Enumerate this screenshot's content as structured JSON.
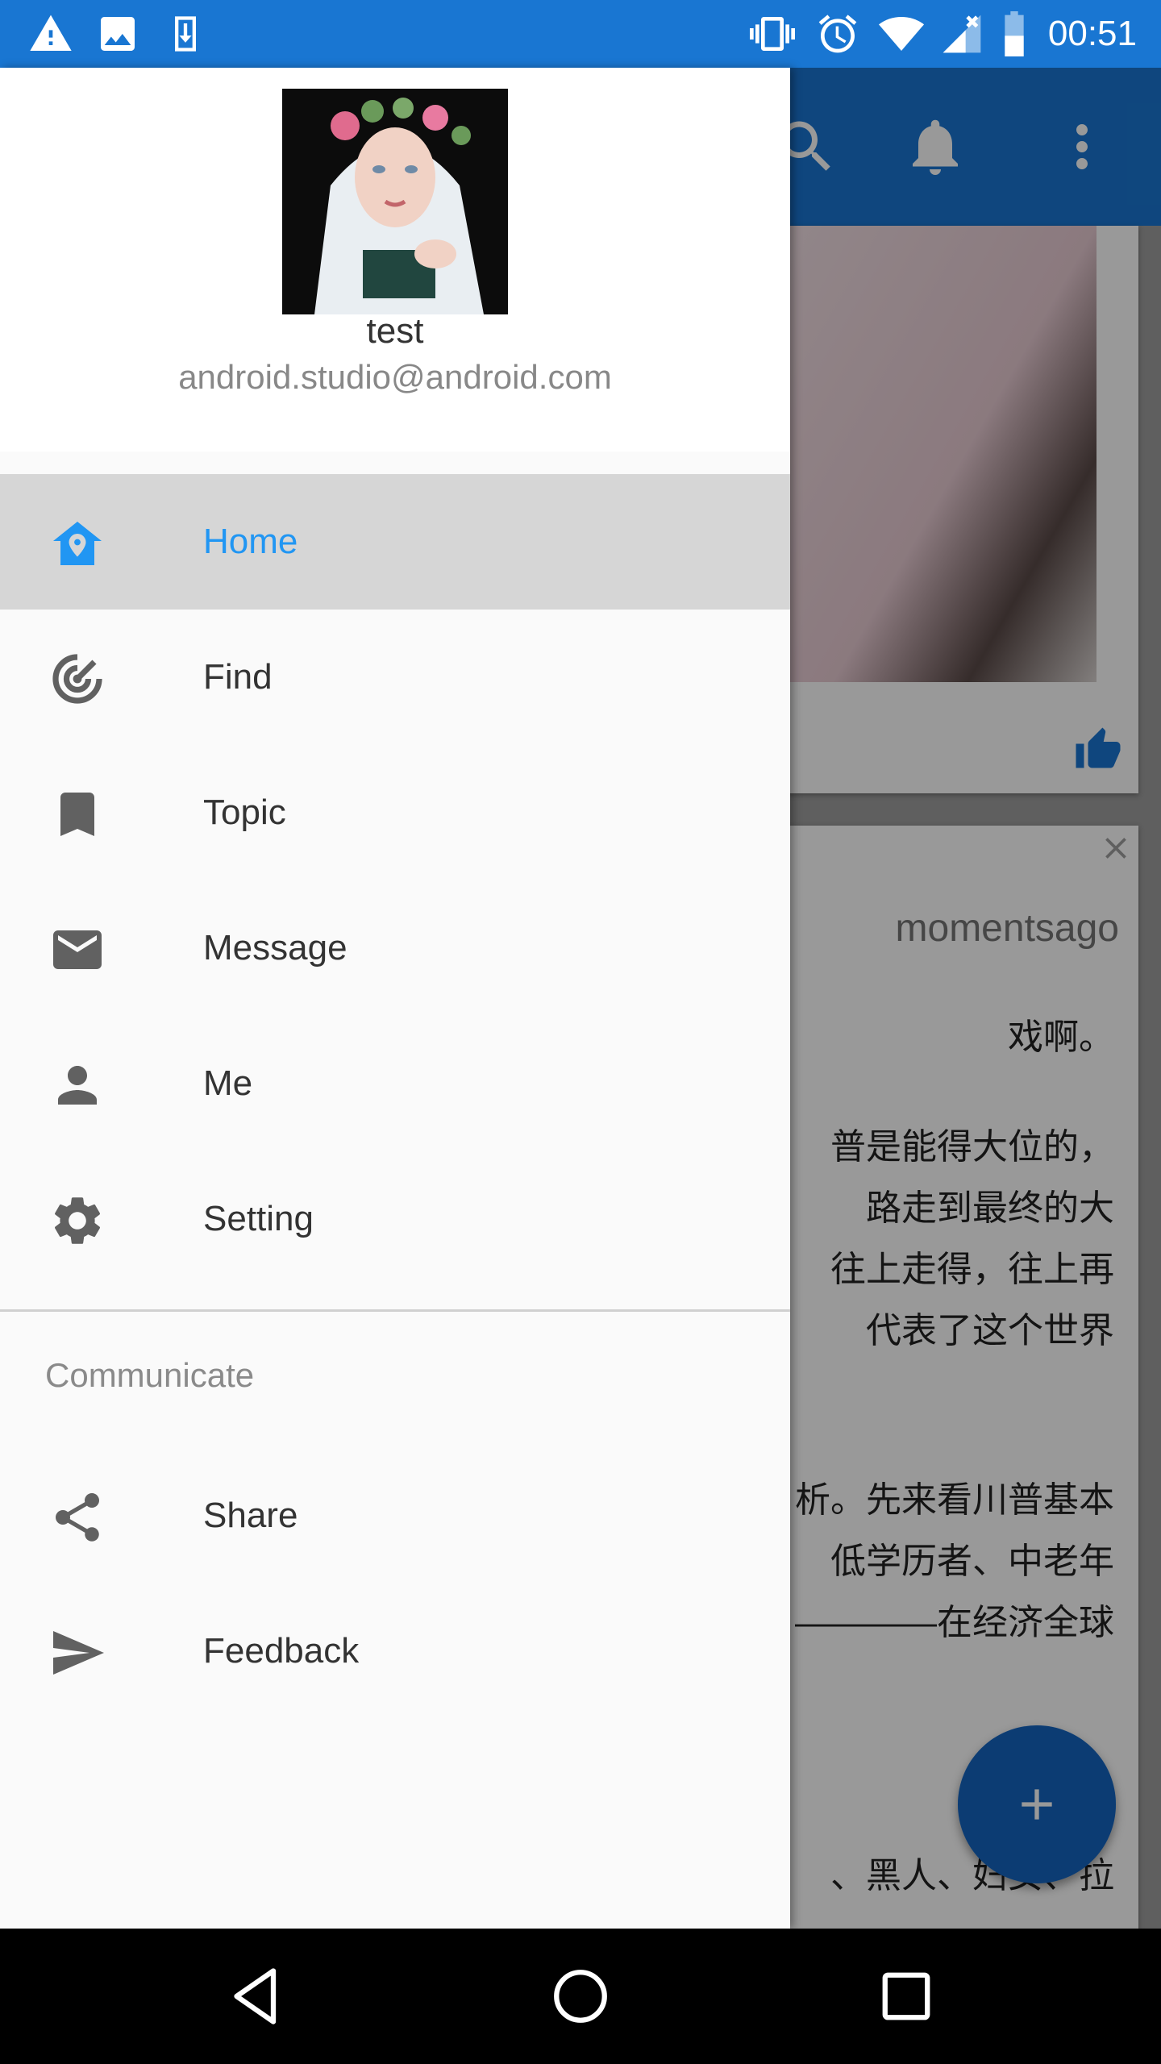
{
  "status_bar": {
    "time": "00:51",
    "left_icons": [
      "warning-icon",
      "image-icon",
      "download-icon"
    ],
    "right_icons": [
      "vibrate-icon",
      "alarm-icon",
      "wifi-icon",
      "signal-icon",
      "battery-icon"
    ]
  },
  "drawer": {
    "header": {
      "name": "test",
      "email": "android.studio@android.com"
    },
    "items": [
      {
        "label": "Home",
        "icon": "home-pin-icon",
        "active": true
      },
      {
        "label": "Find",
        "icon": "radar-icon"
      },
      {
        "label": "Topic",
        "icon": "bookmark-icon"
      },
      {
        "label": "Message",
        "icon": "mail-icon"
      },
      {
        "label": "Me",
        "icon": "person-icon"
      },
      {
        "label": "Setting",
        "icon": "gear-icon"
      }
    ],
    "section_title": "Communicate",
    "section_items": [
      {
        "label": "Share",
        "icon": "share-icon"
      },
      {
        "label": "Feedback",
        "icon": "send-icon"
      }
    ]
  },
  "background": {
    "toolbar_icons": [
      "search-icon",
      "bell-icon",
      "more-vert-icon"
    ],
    "time_ago": "momentsago",
    "text_lines": [
      "戏啊。",
      "普是能得大位的，",
      "路走到最终的大",
      "往上走得，往上再",
      "代表了这个世界",
      "析。先来看川普基本",
      "低学历者、中老年",
      "————在经济全球",
      "、黑人、妇女、拉"
    ]
  },
  "colors": {
    "primary": "#1976D2",
    "accent": "#2196F3",
    "active_row": "#d6d6d6"
  }
}
